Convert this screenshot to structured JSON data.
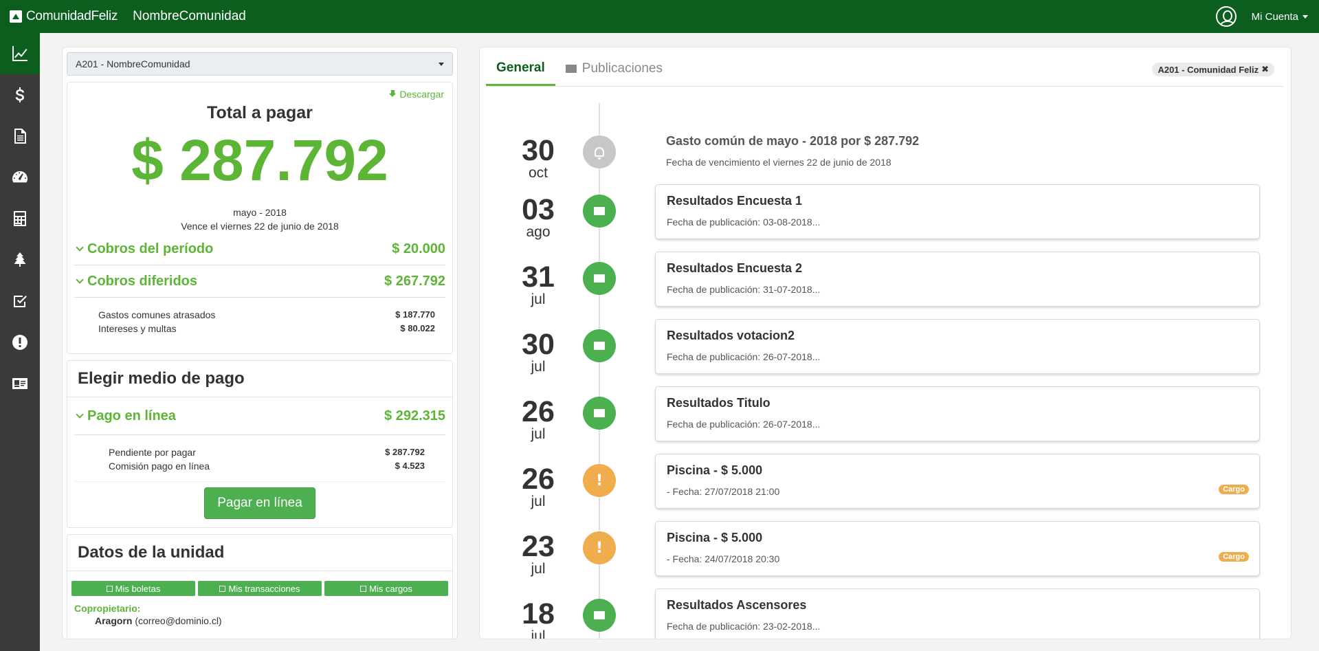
{
  "header": {
    "brand": "ComunidadFeliz",
    "community": "NombreComunidad",
    "account": "Mi Cuenta"
  },
  "sidebar": {
    "items": [
      {
        "icon": "chart-line-icon",
        "active": true
      },
      {
        "icon": "dollar-icon",
        "active": false
      },
      {
        "icon": "document-icon",
        "active": false
      },
      {
        "icon": "dashboard-icon",
        "active": false
      },
      {
        "icon": "calculator-icon",
        "active": false
      },
      {
        "icon": "tree-icon",
        "active": false
      },
      {
        "icon": "checkbox-icon",
        "active": false
      },
      {
        "icon": "alert-icon",
        "active": false
      },
      {
        "icon": "id-card-icon",
        "active": false
      }
    ]
  },
  "left": {
    "unit_select": "A201 - NombreComunidad",
    "download": "Descargar",
    "total_title": "Total a pagar",
    "total_amount": "$ 287.792",
    "period": "mayo - 2018",
    "due": "Vence el viernes 22 de junio de 2018",
    "cobros_periodo": {
      "label": "Cobros del período",
      "amount": "$ 20.000"
    },
    "cobros_diferidos": {
      "label": "Cobros diferidos",
      "amount": "$ 267.792"
    },
    "diferidos_detail": [
      {
        "label": "Gastos comunes atrasados",
        "amount": "$ 187.770"
      },
      {
        "label": "Intereses y multas",
        "amount": "$ 80.022"
      }
    ],
    "medio_title": "Elegir medio de pago",
    "pago_linea": {
      "label": "Pago en línea",
      "amount": "$ 292.315"
    },
    "pago_detail": [
      {
        "label": "Pendiente por pagar",
        "amount": "$ 287.792"
      },
      {
        "label": "Comisión pago en línea",
        "amount": "$ 4.523"
      }
    ],
    "pay_button": "Pagar en línea",
    "unidad_title": "Datos de la unidad",
    "unit_buttons": [
      "Mis boletas",
      "Mis transacciones",
      "Mis cargos"
    ],
    "owner_label": "Copropietario:",
    "owner_name": "Aragorn",
    "owner_email": "(correo@dominio.cl)"
  },
  "right": {
    "tabs": [
      "General",
      "Publicaciones"
    ],
    "filter_chip": "A201 - Comunidad Feliz",
    "timeline": [
      {
        "day": "30",
        "month": "oct",
        "type": "gray",
        "title": "Gasto común de mayo - 2018 por $ 287.792",
        "sub": "Fecha de vencimiento el viernes 22 de junio de 2018",
        "badge": ""
      },
      {
        "day": "03",
        "month": "ago",
        "type": "green",
        "title": "Resultados Encuesta 1",
        "sub": "Fecha de publicación: 03-08-2018...",
        "badge": ""
      },
      {
        "day": "31",
        "month": "jul",
        "type": "green",
        "title": "Resultados Encuesta 2",
        "sub": "Fecha de publicación: 31-07-2018...",
        "badge": ""
      },
      {
        "day": "30",
        "month": "jul",
        "type": "green",
        "title": "Resultados votacion2",
        "sub": "Fecha de publicación: 26-07-2018...",
        "badge": ""
      },
      {
        "day": "26",
        "month": "jul",
        "type": "green",
        "title": "Resultados Titulo",
        "sub": "Fecha de publicación: 26-07-2018...",
        "badge": ""
      },
      {
        "day": "26",
        "month": "jul",
        "type": "orange",
        "title": "Piscina - $ 5.000",
        "sub": "- Fecha: 27/07/2018 21:00",
        "badge": "Cargo"
      },
      {
        "day": "23",
        "month": "jul",
        "type": "orange",
        "title": "Piscina - $ 5.000",
        "sub": "- Fecha: 24/07/2018 20:30",
        "badge": "Cargo"
      },
      {
        "day": "18",
        "month": "jul",
        "type": "green",
        "title": "Resultados Ascensores",
        "sub": "Fecha de publicación: 23-02-2018...",
        "badge": ""
      }
    ]
  }
}
